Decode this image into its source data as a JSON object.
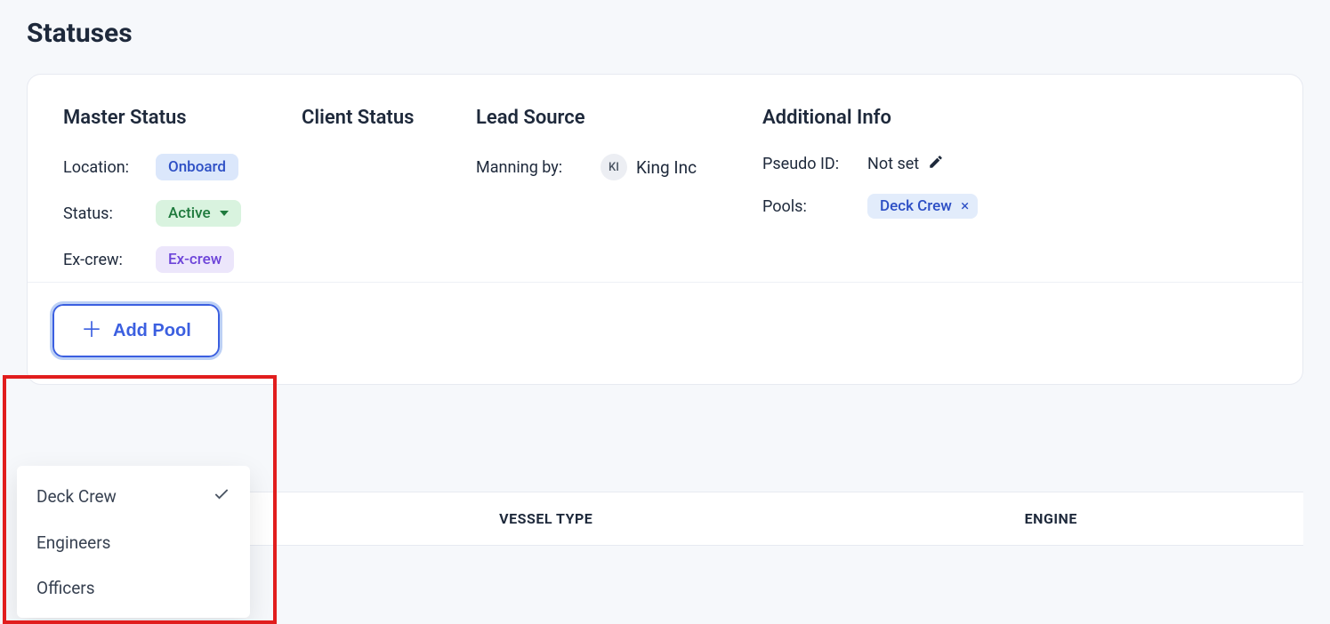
{
  "page": {
    "title": "Statuses"
  },
  "sections": {
    "master": "Master Status",
    "client": "Client Status",
    "lead": "Lead Source",
    "additional": "Additional Info"
  },
  "master": {
    "location_label": "Location:",
    "location_value": "Onboard",
    "status_label": "Status:",
    "status_value": "Active",
    "excrew_label": "Ex-crew:",
    "excrew_value": "Ex-crew"
  },
  "lead": {
    "manning_label": "Manning by:",
    "manning_initials": "KI",
    "manning_name": "King Inc"
  },
  "additional": {
    "pseudo_label": "Pseudo ID:",
    "pseudo_value": "Not set",
    "pools_label": "Pools:",
    "pool_tag": "Deck Crew",
    "pool_tag_close": "×"
  },
  "add_pool": {
    "button_label": "Add Pool",
    "options": [
      {
        "label": "Deck Crew",
        "selected": true
      },
      {
        "label": "Engineers",
        "selected": false
      },
      {
        "label": "Officers",
        "selected": false
      }
    ]
  },
  "table": {
    "headers": {
      "vessel": "VESSEL TYPE",
      "engine": "ENGINE"
    }
  }
}
